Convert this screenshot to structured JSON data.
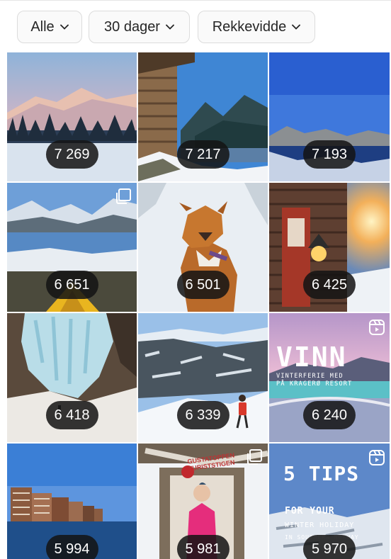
{
  "filters": {
    "all_label": "Alle",
    "period_label": "30 dager",
    "metric_label": "Rekkevidde"
  },
  "posts": [
    {
      "value": "7 269",
      "subject": "snowy mountain sunset"
    },
    {
      "value": "7 217",
      "subject": "log cabin by fjord"
    },
    {
      "value": "7 193",
      "subject": "blue lake reflection"
    },
    {
      "value": "6 651",
      "subject": "fjord with tent",
      "icon": "carousel-icon"
    },
    {
      "value": "6 501",
      "subject": "dog in snow"
    },
    {
      "value": "6 425",
      "subject": "red cabin with lamp"
    },
    {
      "value": "6 418",
      "subject": "frozen waterfall"
    },
    {
      "value": "6 339",
      "subject": "hiker on snowy ridge"
    },
    {
      "value": "6 240",
      "subject": "winter pool",
      "icon": "reel-icon"
    },
    {
      "value": "5 994",
      "subject": "waterfront buildings"
    },
    {
      "value": "5 981",
      "subject": "woman at trail sign",
      "icon": "carousel-icon"
    },
    {
      "value": "5 970",
      "subject": "snowy plateau",
      "icon": "reel-icon"
    }
  ],
  "overlays": {
    "vinn_title": "VINN",
    "vinn_line1": "VINTERFERIE MED",
    "vinn_line2": "PÅ KRAGERØ RESORT",
    "tips_title_1": "5 TIPS",
    "tips_line1": "FOR YOUR",
    "tips_line2": "WINTER HOLIDAY",
    "tips_line3": "IN SOUTHERN NORWAY",
    "sign_line1": "GUSTATOPPEN",
    "sign_line2": "TURISTSTIGEN"
  }
}
